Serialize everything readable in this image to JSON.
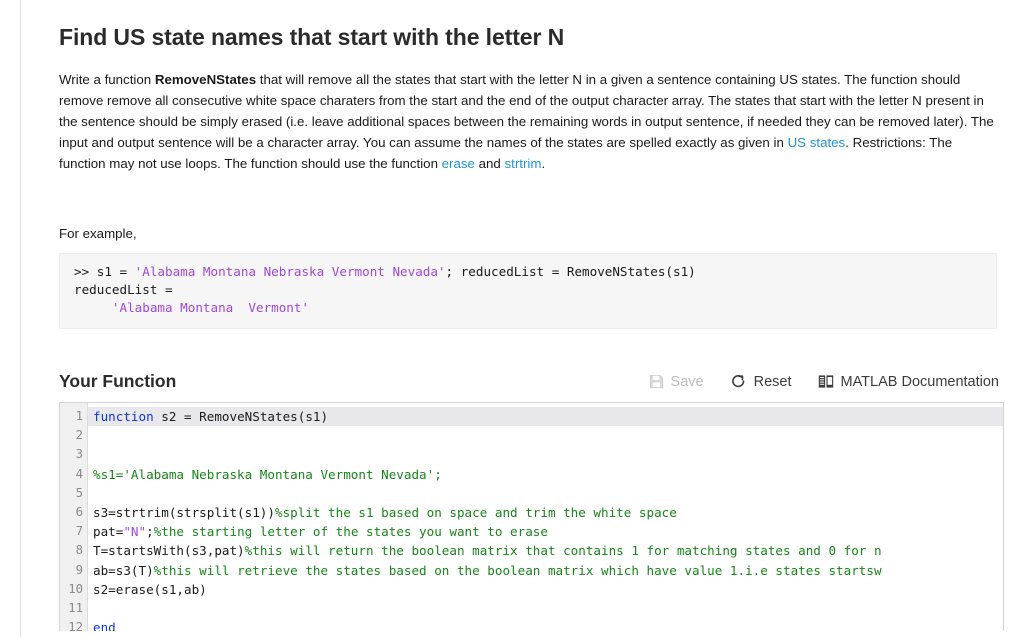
{
  "problem": {
    "title": "Find US state names that start with the letter N",
    "description_parts": [
      {
        "t": "text",
        "v": "Write a function "
      },
      {
        "t": "bold",
        "v": "RemoveNStates"
      },
      {
        "t": "text",
        "v": " that will remove all the states that start with the letter N in a given a sentence containing US states.  The function should remove remove all consecutive white space charaters from the start and the end of the output character array.  The states that start with the letter N present in the sentence should be simply erased (i.e. leave additional spaces between the remaining words in output sentence, if needed they can be removed later). The input and output sentence will be a character array. You can assume the names of the states are spelled exactly as given in "
      },
      {
        "t": "link",
        "v": "US states"
      },
      {
        "t": "text",
        "v": ".   Restrictions:  The function may not use loops. The function should use the function "
      },
      {
        "t": "link",
        "v": "erase"
      },
      {
        "t": "text",
        "v": " and "
      },
      {
        "t": "link",
        "v": "strtrim"
      },
      {
        "t": "text",
        "v": "."
      }
    ],
    "for_example_label": "For example,",
    "example_lines": [
      ">> s1 = 'Alabama Montana Nebraska Vermont Nevada'; reducedList = RemoveNStates(s1)",
      "reducedList =",
      "     'Alabama Montana  Vermont'"
    ],
    "example_string_1": "'Alabama Montana Nebraska Vermont Nevada'",
    "example_string_2": "'Alabama Montana  Vermont'"
  },
  "function_section": {
    "title": "Your Function",
    "toolbar": {
      "save_label": "Save",
      "save_icon": "floppy-disk-icon",
      "save_disabled": true,
      "reset_label": "Reset",
      "reset_icon": "circular-arrow-icon",
      "docs_label": "MATLAB Documentation",
      "docs_icon": "book-icon"
    }
  },
  "editor": {
    "line_numbers": [
      "1",
      "2",
      "3",
      "4",
      "5",
      "6",
      "7",
      "8",
      "9",
      "10",
      "11",
      "12"
    ],
    "active_line": 1,
    "lines": [
      {
        "n": 1,
        "segments": [
          {
            "t": "kw",
            "v": "function"
          },
          {
            "t": "plain",
            "v": " s2 = RemoveNStates(s1)"
          }
        ]
      },
      {
        "n": 2,
        "segments": [
          {
            "t": "plain",
            "v": ""
          }
        ]
      },
      {
        "n": 3,
        "segments": [
          {
            "t": "plain",
            "v": ""
          }
        ]
      },
      {
        "n": 4,
        "segments": [
          {
            "t": "cmt",
            "v": "%s1='Alabama Nebraska Montana Vermont Nevada';"
          }
        ]
      },
      {
        "n": 5,
        "segments": [
          {
            "t": "plain",
            "v": ""
          }
        ]
      },
      {
        "n": 6,
        "segments": [
          {
            "t": "plain",
            "v": "s3=strtrim(strsplit(s1))"
          },
          {
            "t": "cmt",
            "v": "%split the s1 based on space and trim the white space"
          }
        ]
      },
      {
        "n": 7,
        "segments": [
          {
            "t": "plain",
            "v": "pat="
          },
          {
            "t": "cstr",
            "v": "\"N\""
          },
          {
            "t": "plain",
            "v": ";"
          },
          {
            "t": "cmt",
            "v": "%the starting letter of the states you want to erase"
          }
        ]
      },
      {
        "n": 8,
        "segments": [
          {
            "t": "plain",
            "v": "T=startsWith(s3,pat)"
          },
          {
            "t": "cmt",
            "v": "%this will return the boolean matrix that contains 1 for matching states and 0 for n"
          }
        ]
      },
      {
        "n": 9,
        "segments": [
          {
            "t": "plain",
            "v": "ab=s3(T)"
          },
          {
            "t": "cmt",
            "v": "%this will retrieve the states based on the boolean matrix which have value 1.i.e states startsw"
          }
        ]
      },
      {
        "n": 10,
        "segments": [
          {
            "t": "plain",
            "v": "s2=erase(s1,ab)"
          }
        ]
      },
      {
        "n": 11,
        "segments": [
          {
            "t": "plain",
            "v": ""
          }
        ]
      },
      {
        "n": 12,
        "segments": [
          {
            "t": "kw",
            "v": "end"
          }
        ]
      }
    ]
  },
  "colors": {
    "link": "#2196d4",
    "keyword": "#0b36d6",
    "comment": "#18851a",
    "string": "#a048d8",
    "example_bg": "#f6f6f6",
    "gutter_bg": "#f0f0f0",
    "active_line_bg": "#e8e8ec"
  }
}
